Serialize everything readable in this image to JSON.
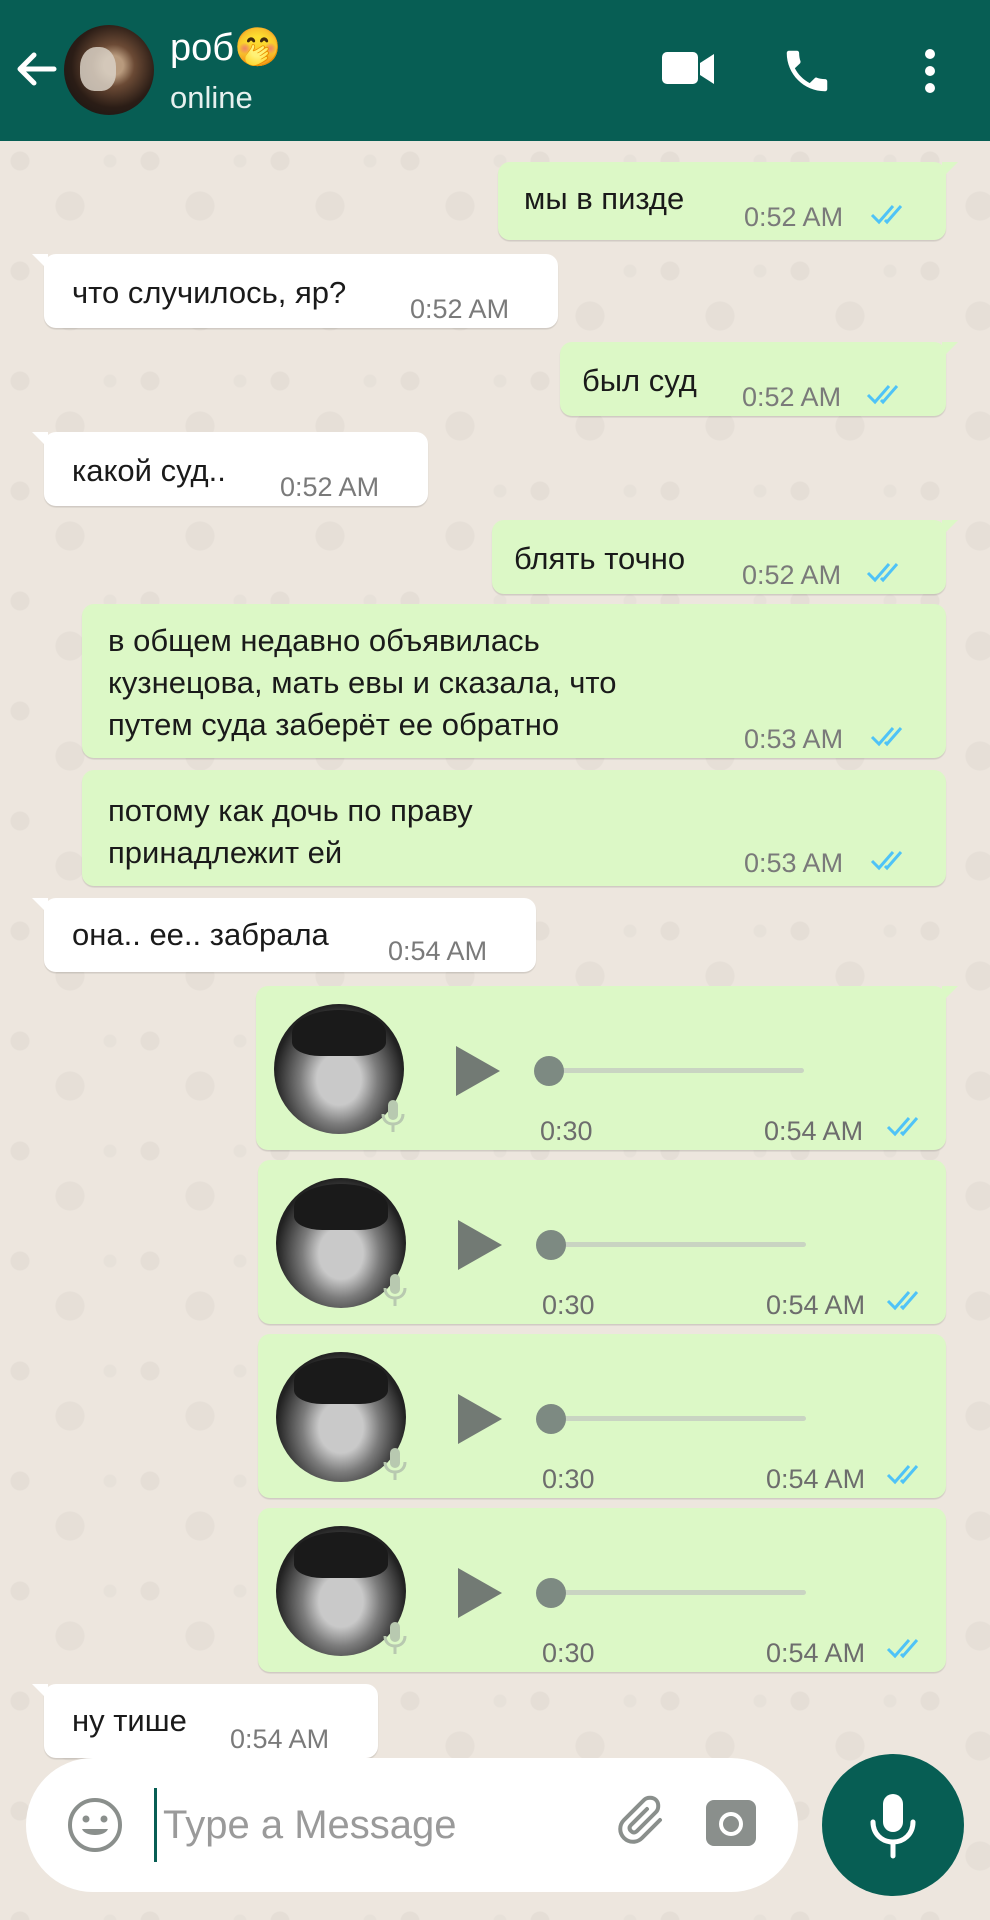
{
  "header": {
    "contact_name": "роб🤭",
    "status": "online"
  },
  "messages": [
    {
      "dir": "out",
      "text": "мы в пизде",
      "time": "0:52 AM"
    },
    {
      "dir": "in",
      "text": "что случилось, яр?",
      "time": "0:52 AM"
    },
    {
      "dir": "out",
      "text": "был суд",
      "time": "0:52 AM"
    },
    {
      "dir": "in",
      "text": "какой суд..",
      "time": "0:52 AM"
    },
    {
      "dir": "out",
      "text": "блять точно",
      "time": "0:52 AM"
    },
    {
      "dir": "out",
      "lines": [
        "в общем недавно объявилась",
        "кузнецова, мать евы и сказала, что",
        "путем суда заберёт ее обратно"
      ],
      "time": "0:53 AM"
    },
    {
      "dir": "out",
      "lines": [
        "потому как дочь по праву",
        "принадлежит ей"
      ],
      "time": "0:53 AM"
    },
    {
      "dir": "in",
      "text": "она.. ее.. забрала",
      "time": "0:54 AM"
    },
    {
      "dir": "in",
      "text": "ну тише",
      "time": "0:54 AM"
    }
  ],
  "voice_messages": [
    {
      "duration": "0:30",
      "time": "0:54 AM",
      "progress": 0
    },
    {
      "duration": "0:30",
      "time": "0:54 AM",
      "progress": 0
    },
    {
      "duration": "0:30",
      "time": "0:54 AM",
      "progress": 0
    },
    {
      "duration": "0:30",
      "time": "0:54 AM",
      "progress": 0
    }
  ],
  "composer": {
    "placeholder": "Type a Message"
  },
  "colors": {
    "header": "#075e54",
    "outgoing_bubble": "#dcf8c6",
    "incoming_bubble": "#ffffff",
    "read_ticks": "#4fc3f7"
  }
}
